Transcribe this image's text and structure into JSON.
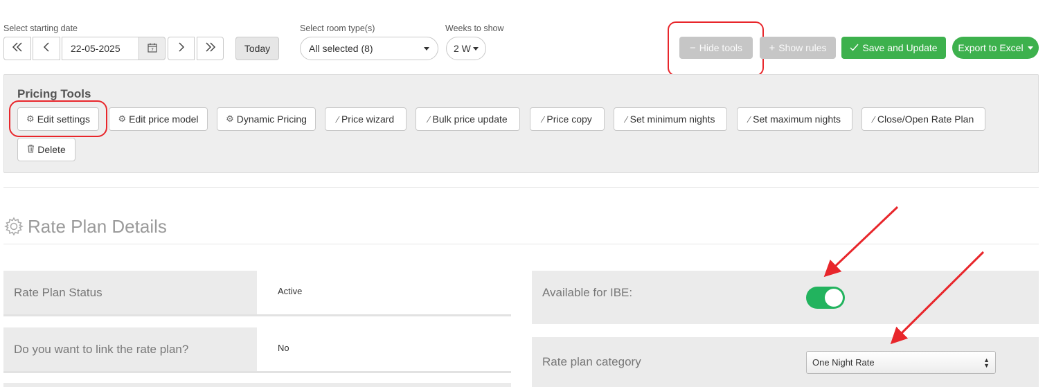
{
  "toolbar": {
    "start_date_label": "Select starting date",
    "start_date_value": "22-05-2025",
    "today_label": "Today",
    "room_type_label": "Select room type(s)",
    "room_type_value": "All selected (8)",
    "weeks_label": "Weeks to show",
    "weeks_value": "2 W",
    "hide_tools_label": "Hide tools",
    "show_rules_label": "Show rules",
    "save_update_label": "Save and Update",
    "export_label": "Export to Excel"
  },
  "pricing_tools": {
    "title": "Pricing Tools",
    "buttons": [
      {
        "label": "Edit settings",
        "icon": "gear-icon"
      },
      {
        "label": "Edit price model",
        "icon": "gear-icon"
      },
      {
        "label": "Dynamic Pricing",
        "icon": "gear-icon"
      },
      {
        "label": "Price wizard",
        "icon": "wand-icon"
      },
      {
        "label": "Bulk price update",
        "icon": "wand-icon"
      },
      {
        "label": "Price copy",
        "icon": "wand-icon"
      },
      {
        "label": "Set minimum nights",
        "icon": "wand-icon"
      },
      {
        "label": "Set maximum nights",
        "icon": "wand-icon"
      },
      {
        "label": "Close/Open Rate Plan",
        "icon": "wand-icon"
      },
      {
        "label": "Delete",
        "icon": "trash-icon"
      }
    ]
  },
  "rate_plan_details": {
    "title": "Rate Plan Details",
    "status_label": "Rate Plan Status",
    "status_value": "Active",
    "link_label": "Do you want to link the rate plan?",
    "link_value": "No",
    "ibe_label": "Available for IBE:",
    "ibe_on": true,
    "category_label": "Rate plan category",
    "category_value": "One Night Rate"
  },
  "colors": {
    "green": "#3db14d",
    "toggle_green": "#22b35e",
    "annotation_red": "#e8262b",
    "disabled_grey": "#c6c6c6"
  }
}
